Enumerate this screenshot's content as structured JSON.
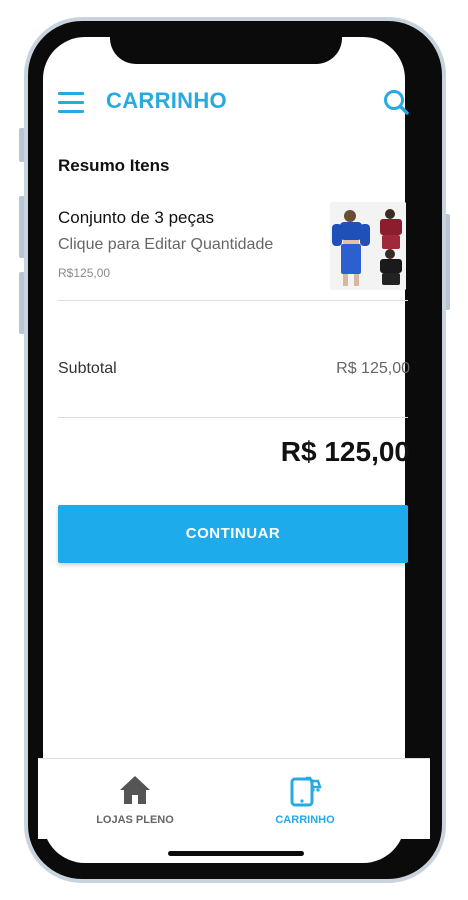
{
  "app": {
    "title": "CARRINHO",
    "accent_color": "#29a9e1",
    "button_color": "#1eabec"
  },
  "header": {
    "menu_icon": "hamburger-menu-icon",
    "search_icon": "search-icon"
  },
  "cart": {
    "section_title": "Resumo Itens",
    "items": [
      {
        "name": "Conjunto de 3 peças",
        "hint": "Clique para Editar Quantidade",
        "price": "R$125,00",
        "image": "product-thumbnail"
      }
    ],
    "subtotal_label": "Subtotal",
    "subtotal_value": "R$ 125,00",
    "total_value": "R$ 125,00",
    "continue_label": "CONTINUAR"
  },
  "bottom_nav": {
    "items": [
      {
        "label": "LOJAS PLENO",
        "icon": "home-icon",
        "active": false
      },
      {
        "label": "CARRINHO",
        "icon": "cart-phone-icon",
        "active": true
      }
    ]
  }
}
